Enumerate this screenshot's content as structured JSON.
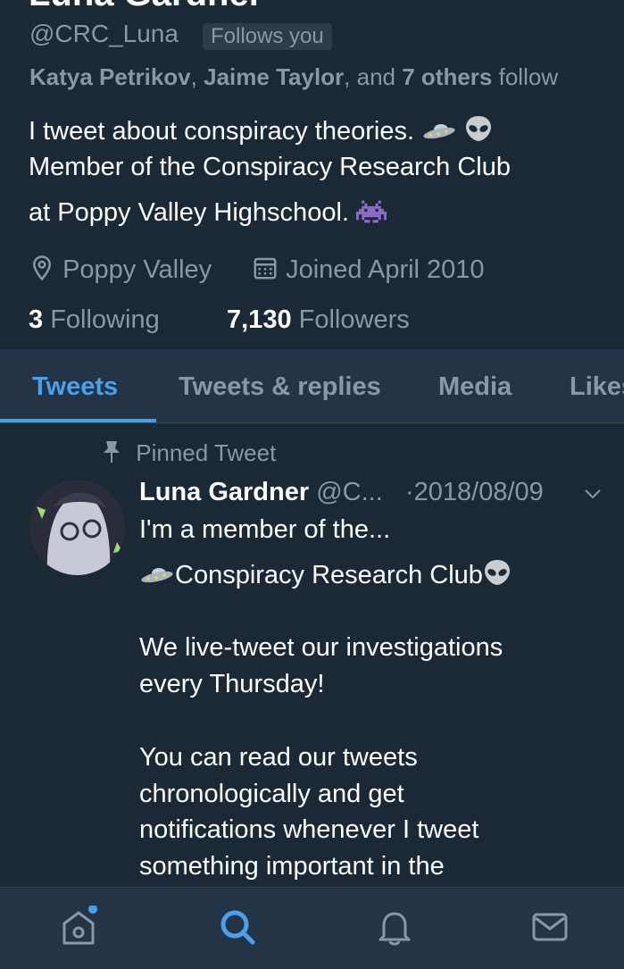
{
  "profile": {
    "display_name": "Luna Gardner",
    "handle": "@CRC_Luna",
    "follows_you": "Follows you",
    "followed_by": {
      "name1": "Katya Petrikov",
      "sep1": ",",
      "name2": "Jaime Taylor",
      "sep2": ", and",
      "others": "7 others",
      "suffix": "follow"
    },
    "bio": {
      "line1": "I tweet about conspiracy theories.",
      "line2": "Member of the Conspiracy Research Club",
      "line3": "at Poppy Valley Highschool."
    },
    "location": "Poppy Valley",
    "joined": "Joined April 2010",
    "following_count": "3",
    "following_label": "Following",
    "followers_count": "7,130",
    "followers_label": "Followers"
  },
  "tabs": [
    {
      "label": "Tweets",
      "active": true
    },
    {
      "label": "Tweets & replies"
    },
    {
      "label": "Media"
    },
    {
      "label": "Likes"
    }
  ],
  "tweet": {
    "pinned_label": "Pinned Tweet",
    "author_name": "Luna Gardner",
    "author_handle": "@C...",
    "date": "·2018/08/09",
    "lines": {
      "l1": "I'm a member of the...",
      "l2": "Conspiracy Research Club",
      "l3": "We live-tweet our investigations",
      "l4": "every Thursday!",
      "l5": "You can read our tweets",
      "l6": "chronologically and get",
      "l7": "notifications whenever I tweet",
      "l8": "something important in the"
    }
  },
  "icons": {
    "ufo": "ufo-icon",
    "alien": "alien-icon",
    "space_invader": "space-invader-icon",
    "location": "location-pin-icon",
    "calendar": "calendar-icon",
    "pin": "pin-icon",
    "caret": "chevron-down-icon",
    "home": "home-icon",
    "search": "search-icon",
    "notifications": "bell-icon",
    "messages": "mail-icon"
  },
  "colors": {
    "background": "#1b2836",
    "accent": "#4aa1eb",
    "muted": "#8899a6"
  }
}
